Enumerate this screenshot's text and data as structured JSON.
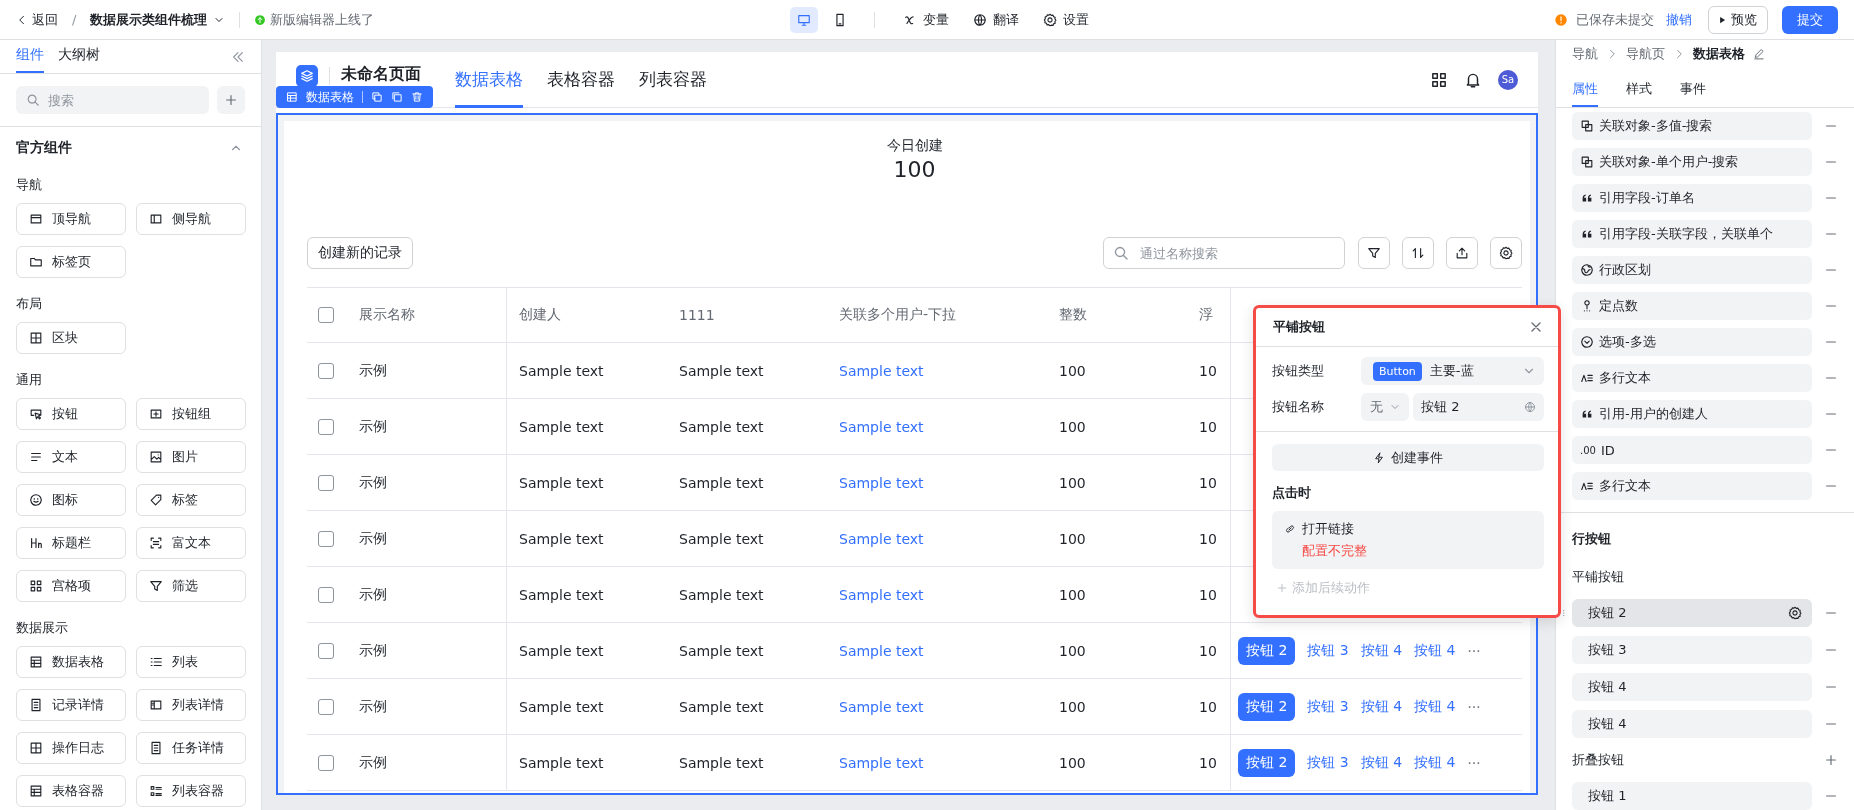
{
  "top_bar": {
    "back": "返回",
    "separator": "/",
    "project": "数据展示类组件梳理",
    "notice": "新版编辑器上线了",
    "devices": [
      {
        "kind": "desktop",
        "selected": true
      },
      {
        "kind": "mobile",
        "selected": false
      }
    ],
    "tools": [
      {
        "kind": "variable",
        "label": "变量"
      },
      {
        "kind": "translate",
        "label": "翻译"
      },
      {
        "kind": "settings",
        "label": "设置"
      }
    ],
    "save_status": "已保存未提交",
    "undo": "撤销",
    "preview": "预览",
    "submit": "提交"
  },
  "left_panel": {
    "tabs": [
      {
        "label": "组件",
        "selected": true
      },
      {
        "label": "大纲树",
        "selected": false
      }
    ],
    "search": {
      "placeholder": "搜索"
    },
    "section": {
      "title": "官方组件",
      "expanded": true
    },
    "groups": [
      {
        "title": "导航",
        "items": [
          "顶导航",
          "侧导航",
          "标签页"
        ]
      },
      {
        "title": "布局",
        "items": [
          "区块"
        ]
      },
      {
        "title": "通用",
        "items": [
          "按钮",
          "按钮组",
          "文本",
          "图片",
          "图标",
          "标签",
          "标题栏",
          "富文本",
          "宫格项",
          "筛选"
        ]
      },
      {
        "title": "数据展示",
        "items": [
          "数据表格",
          "列表",
          "记录详情",
          "列表详情",
          "操作日志",
          "任务详情",
          "表格容器",
          "列表容器"
        ]
      }
    ]
  },
  "canvas": {
    "page": {
      "title": "未命名页面",
      "tabs": [
        {
          "label": "数据表格",
          "selected": true
        },
        {
          "label": "表格容器",
          "selected": false
        },
        {
          "label": "列表容器",
          "selected": false
        }
      ],
      "avatar": "Sa"
    },
    "selection_tag": "数据表格",
    "stat": {
      "label": "今日创建",
      "value": "100"
    },
    "create_button": "创建新的记录",
    "search": {
      "placeholder": "通过名称搜索"
    },
    "table": {
      "select_all": {
        "checked": false
      },
      "columns": [
        {
          "label": "展示名称",
          "kind": "text"
        },
        {
          "label": "创建人",
          "kind": "text"
        },
        {
          "label": "1111",
          "kind": "text"
        },
        {
          "label": "关联多个用户-下拉",
          "kind": "link"
        },
        {
          "label": "整数",
          "kind": "text"
        },
        {
          "label": "浮",
          "kind": "text"
        }
      ],
      "rows": [
        {
          "checked": false,
          "cells": [
            "示例",
            "Sample text",
            "Sample text",
            "Sample text",
            "100",
            "10"
          ],
          "actions": []
        },
        {
          "checked": false,
          "cells": [
            "示例",
            "Sample text",
            "Sample text",
            "Sample text",
            "100",
            "10"
          ],
          "actions": []
        },
        {
          "checked": false,
          "cells": [
            "示例",
            "Sample text",
            "Sample text",
            "Sample text",
            "100",
            "10"
          ],
          "actions": []
        },
        {
          "checked": false,
          "cells": [
            "示例",
            "Sample text",
            "Sample text",
            "Sample text",
            "100",
            "10"
          ],
          "actions": []
        },
        {
          "checked": false,
          "cells": [
            "示例",
            "Sample text",
            "Sample text",
            "Sample text",
            "100",
            "10"
          ],
          "actions": []
        },
        {
          "checked": false,
          "cells": [
            "示例",
            "Sample text",
            "Sample text",
            "Sample text",
            "100",
            "10"
          ],
          "actions": [
            {
              "label": "按钮 2",
              "kind": "primary"
            },
            {
              "label": "按钮 3",
              "kind": "link"
            },
            {
              "label": "按钮 4",
              "kind": "link"
            },
            {
              "label": "按钮 4",
              "kind": "link"
            }
          ]
        },
        {
          "checked": false,
          "cells": [
            "示例",
            "Sample text",
            "Sample text",
            "Sample text",
            "100",
            "10"
          ],
          "actions": [
            {
              "label": "按钮 2",
              "kind": "primary"
            },
            {
              "label": "按钮 3",
              "kind": "link"
            },
            {
              "label": "按钮 4",
              "kind": "link"
            },
            {
              "label": "按钮 4",
              "kind": "link"
            }
          ]
        },
        {
          "checked": false,
          "cells": [
            "示例",
            "Sample text",
            "Sample text",
            "Sample text",
            "100",
            "10"
          ],
          "actions": [
            {
              "label": "按钮 2",
              "kind": "primary"
            },
            {
              "label": "按钮 3",
              "kind": "link"
            },
            {
              "label": "按钮 4",
              "kind": "link"
            },
            {
              "label": "按钮 4",
              "kind": "link"
            }
          ]
        }
      ]
    }
  },
  "popup": {
    "title": "平铺按钮",
    "type_field": {
      "label": "按钮类型",
      "tag": "Button",
      "value": "主要-蓝"
    },
    "name_field": {
      "label": "按钮名称",
      "prefix": "无",
      "value": "按钮 2"
    },
    "create_event": "创建事件",
    "on_click": {
      "title": "点击时",
      "actions": [
        {
          "label": "打开链接",
          "warning": "配置不完整"
        }
      ]
    },
    "add_action": {
      "label": "添加后续动作",
      "disabled": true
    }
  },
  "right_panel": {
    "breadcrumb": [
      "导航",
      "导航页",
      "数据表格"
    ],
    "tabs": [
      {
        "label": "属性",
        "selected": true
      },
      {
        "label": "样式",
        "selected": false
      },
      {
        "label": "事件",
        "selected": false
      }
    ],
    "fields": [
      {
        "label": "关联对象-多值-搜索",
        "kind": "lookup"
      },
      {
        "label": "关联对象-单个用户-搜索",
        "kind": "lookup"
      },
      {
        "label": "引用字段-订单名",
        "kind": "quote"
      },
      {
        "label": "引用字段-关联字段，关联单个",
        "kind": "quote"
      },
      {
        "label": "行政区划",
        "kind": "region"
      },
      {
        "label": "定点数",
        "kind": "decimal"
      },
      {
        "label": "选项-多选",
        "kind": "option"
      },
      {
        "label": "多行文本",
        "kind": "multiline"
      },
      {
        "label": "引用-用户的创建人",
        "kind": "quote"
      },
      {
        "label": "ID",
        "kind": "number",
        "icon_text": ".00"
      },
      {
        "label": "多行文本",
        "kind": "multiline"
      }
    ],
    "row_buttons": {
      "title": "行按钮",
      "tiled": {
        "title": "平铺按钮",
        "items": [
          {
            "label": "按钮 2",
            "selected": true
          },
          {
            "label": "按钮 3",
            "selected": false
          },
          {
            "label": "按钮 4",
            "selected": false
          },
          {
            "label": "按钮 4",
            "selected": false
          }
        ]
      },
      "collapsed": {
        "title": "折叠按钮",
        "items": [
          {
            "label": "按钮 1",
            "selected": false
          }
        ]
      }
    }
  }
}
